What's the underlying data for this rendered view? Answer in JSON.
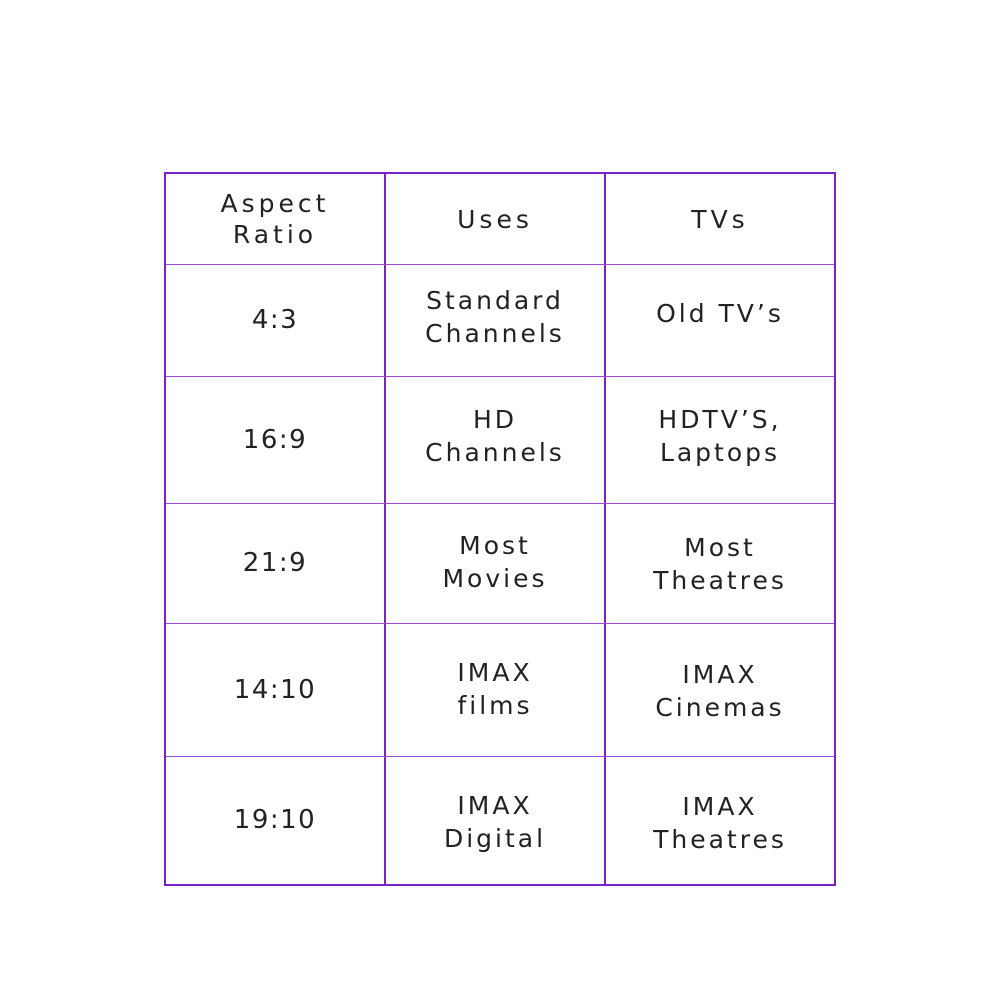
{
  "table": {
    "headers": [
      "Aspect\nRatio",
      "Uses",
      "TVs"
    ],
    "rows": [
      [
        "4:3",
        "Standard\nChannels",
        "Old TV’s"
      ],
      [
        "16:9",
        "HD\nChannels",
        "HDTV’S,\nLaptops"
      ],
      [
        "21:9",
        "Most\nMovies",
        "Most\nTheatres"
      ],
      [
        "14:10",
        "IMAX\nfilms",
        "IMAX\nCinemas"
      ],
      [
        "19:10",
        "IMAX\nDigital",
        "IMAX\nTheatres"
      ]
    ],
    "border_color": "#7a22c8"
  }
}
